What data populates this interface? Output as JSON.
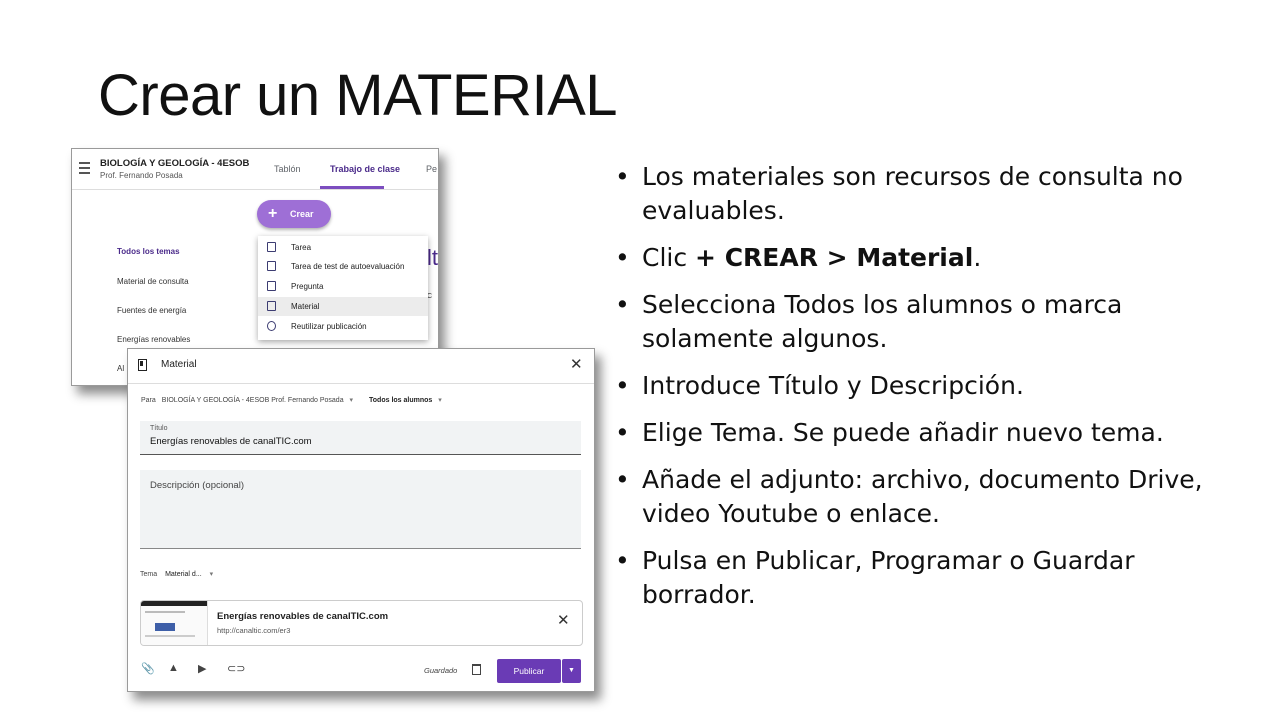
{
  "slide": {
    "title": "Crear un MATERIAL",
    "bullets": [
      {
        "pre": "Los materiales son recursos de consulta no evaluables.",
        "bold": "",
        "post": ""
      },
      {
        "pre": "Clic ",
        "bold": "+ CREAR > Material",
        "post": "."
      },
      {
        "pre": "Selecciona Todos los alumnos o marca solamente algunos.",
        "bold": "",
        "post": ""
      },
      {
        "pre": "Introduce Título y Descripción.",
        "bold": "",
        "post": ""
      },
      {
        "pre": "Elige Tema. Se puede añadir nuevo tema.",
        "bold": "",
        "post": ""
      },
      {
        "pre": "Añade el adjunto: archivo, documento Drive, video Youtube o enlace.",
        "bold": "",
        "post": ""
      },
      {
        "pre": "Pulsa en Publicar, Programar o Guardar borrador.",
        "bold": "",
        "post": ""
      }
    ]
  },
  "classroom": {
    "course": "BIOLOGÍA Y GEOLOGÍA - 4ESOB",
    "teacher": "Prof. Fernando Posada",
    "tabs": [
      "Tablón",
      "Trabajo de clase",
      "Pe"
    ],
    "active_tab": "Trabajo de clase",
    "create_label": "Crear",
    "topics": [
      "Todos los temas",
      "Material de consulta",
      "Fuentes de energía",
      "Energías renovables",
      "Al"
    ],
    "menu": [
      "Tarea",
      "Tarea de test de autoevaluación",
      "Pregunta",
      "Material",
      "Reutilizar publicación"
    ],
    "menu_highlight": "Material",
    "clipped_heading": "lt",
    "clipped_text": "C"
  },
  "dialog": {
    "title": "Material",
    "for_label": "Para",
    "course_selected": "BIOLOGÍA Y GEOLOGÍA - 4ESOB Prof. Fernando Posada",
    "students_selected": "Todos los alumnos",
    "title_label": "Título",
    "title_value": "Energías renovables de canalTIC.com",
    "description_placeholder": "Descripción (opcional)",
    "theme_label": "Tema",
    "theme_value": "Material d...",
    "attachment": {
      "title": "Energías renovables de canalTIC.com",
      "url": "http://canaltic.com/er3"
    },
    "saved_label": "Guardado",
    "publish_label": "Publicar",
    "icons": [
      "attach-icon",
      "drive-icon",
      "youtube-icon",
      "link-icon"
    ]
  },
  "colors": {
    "accent": "#6a3bb5",
    "create_button": "#9e6fd6"
  }
}
